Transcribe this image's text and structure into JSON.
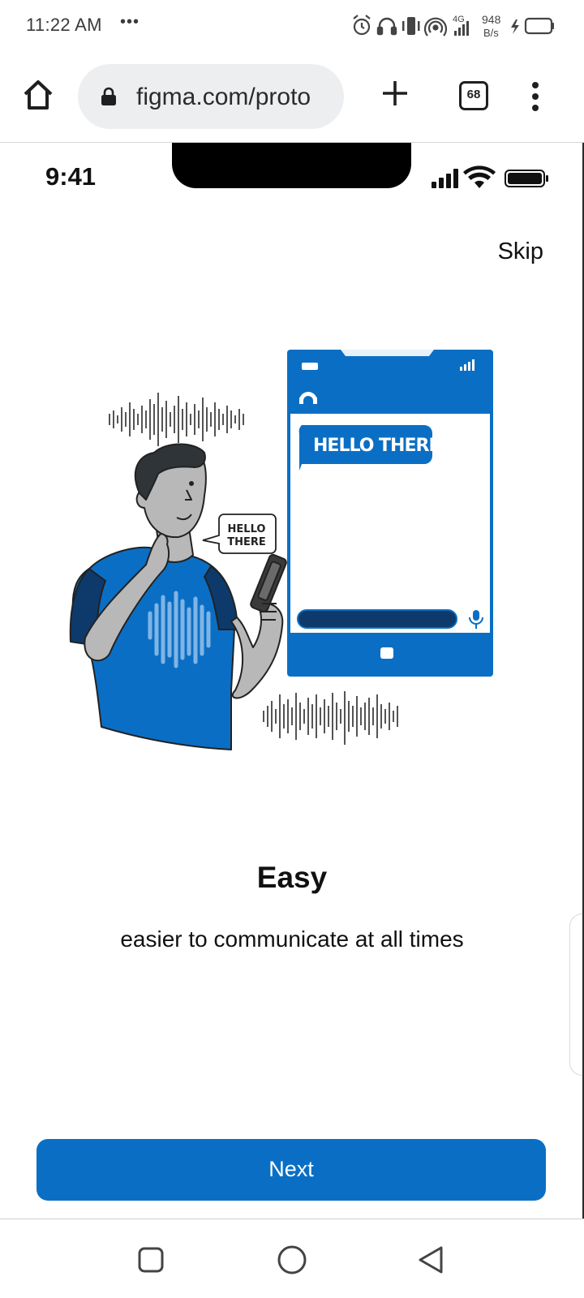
{
  "system_bar": {
    "time": "11:22 AM",
    "dots": "•••",
    "network_type": "4G",
    "speed_value": "948",
    "speed_unit": "B/s"
  },
  "browser": {
    "url": "figma.com/proto",
    "tab_count": "68"
  },
  "prototype": {
    "status_time": "9:41",
    "skip_label": "Skip",
    "illustration": {
      "phone_bubble": "HELLO THERE",
      "speech_bubble_line1": "HELLO",
      "speech_bubble_line2": "THERE"
    },
    "title": "Easy",
    "subtitle": "easier to communicate at all times",
    "next_label": "Next"
  },
  "colors": {
    "accent": "#0a6fc4",
    "dark_navy": "#0d3a6b",
    "text": "#111111"
  },
  "icons": {
    "home": "home-icon",
    "lock": "lock-icon",
    "plus": "plus-icon",
    "tabs": "tabs-icon",
    "menu": "kebab-menu-icon",
    "nav_recents": "square-icon",
    "nav_home": "circle-icon",
    "nav_back": "triangle-back-icon"
  }
}
